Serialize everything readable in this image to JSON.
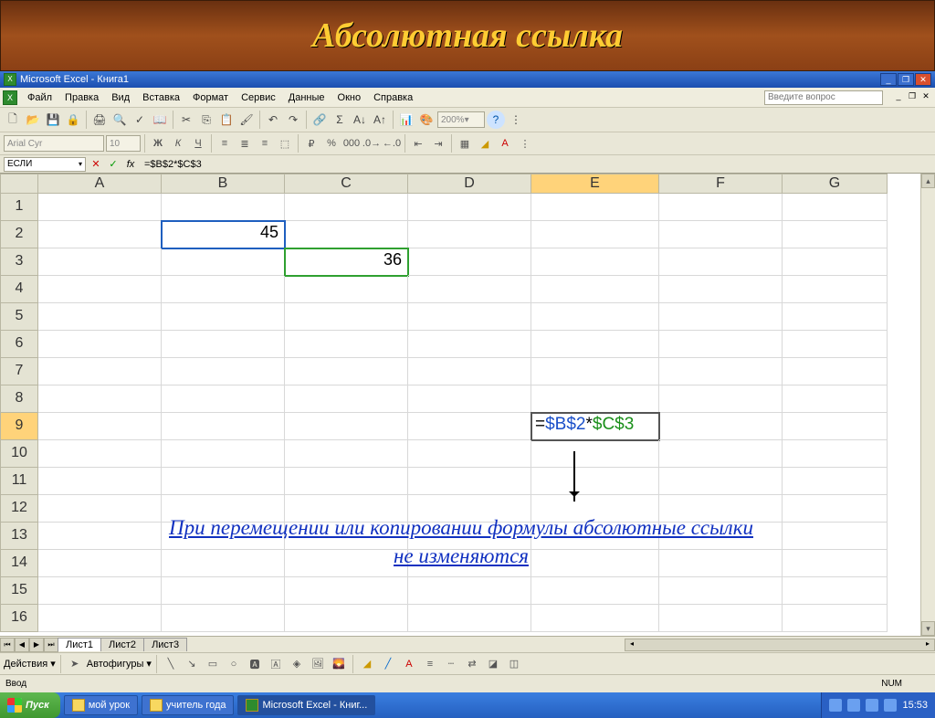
{
  "slide": {
    "title": "Абсолютная ссылка"
  },
  "window": {
    "title": "Microsoft Excel - Книга1"
  },
  "menu": {
    "items": [
      "Файл",
      "Правка",
      "Вид",
      "Вставка",
      "Формат",
      "Сервис",
      "Данные",
      "Окно",
      "Справка"
    ],
    "ask_placeholder": "Введите вопрос"
  },
  "format_bar": {
    "font": "Arial Cyr",
    "size": "10"
  },
  "toolbar": {
    "zoom": "200%"
  },
  "fx": {
    "name_box": "ЕСЛИ",
    "formula": "=$B$2*$C$3",
    "fx_label": "fx"
  },
  "columns": [
    "A",
    "B",
    "C",
    "D",
    "E",
    "F",
    "G"
  ],
  "rows": [
    "1",
    "2",
    "3",
    "4",
    "5",
    "6",
    "7",
    "8",
    "9",
    "10",
    "11",
    "12",
    "13",
    "14",
    "15",
    "16"
  ],
  "cells": {
    "B2": "45",
    "C3": "36",
    "E9": {
      "eq": "=",
      "ref1": "$B$2",
      "op": "*",
      "ref2": "$C$3"
    }
  },
  "note": "При перемещении или копировании формулы абсолютные ссылки не изменяются",
  "sheets": {
    "nav": [
      "⏮",
      "◀",
      "▶",
      "⏭"
    ],
    "tabs": [
      "Лист1",
      "Лист2",
      "Лист3"
    ]
  },
  "draw_bar": {
    "actions": "Действия",
    "autoshapes": "Автофигуры"
  },
  "status": {
    "mode": "Ввод",
    "num": "NUM"
  },
  "taskbar": {
    "start": "Пуск",
    "items": [
      "мой урок",
      "учитель года",
      "Microsoft Excel - Книг..."
    ],
    "time": "15:53"
  }
}
